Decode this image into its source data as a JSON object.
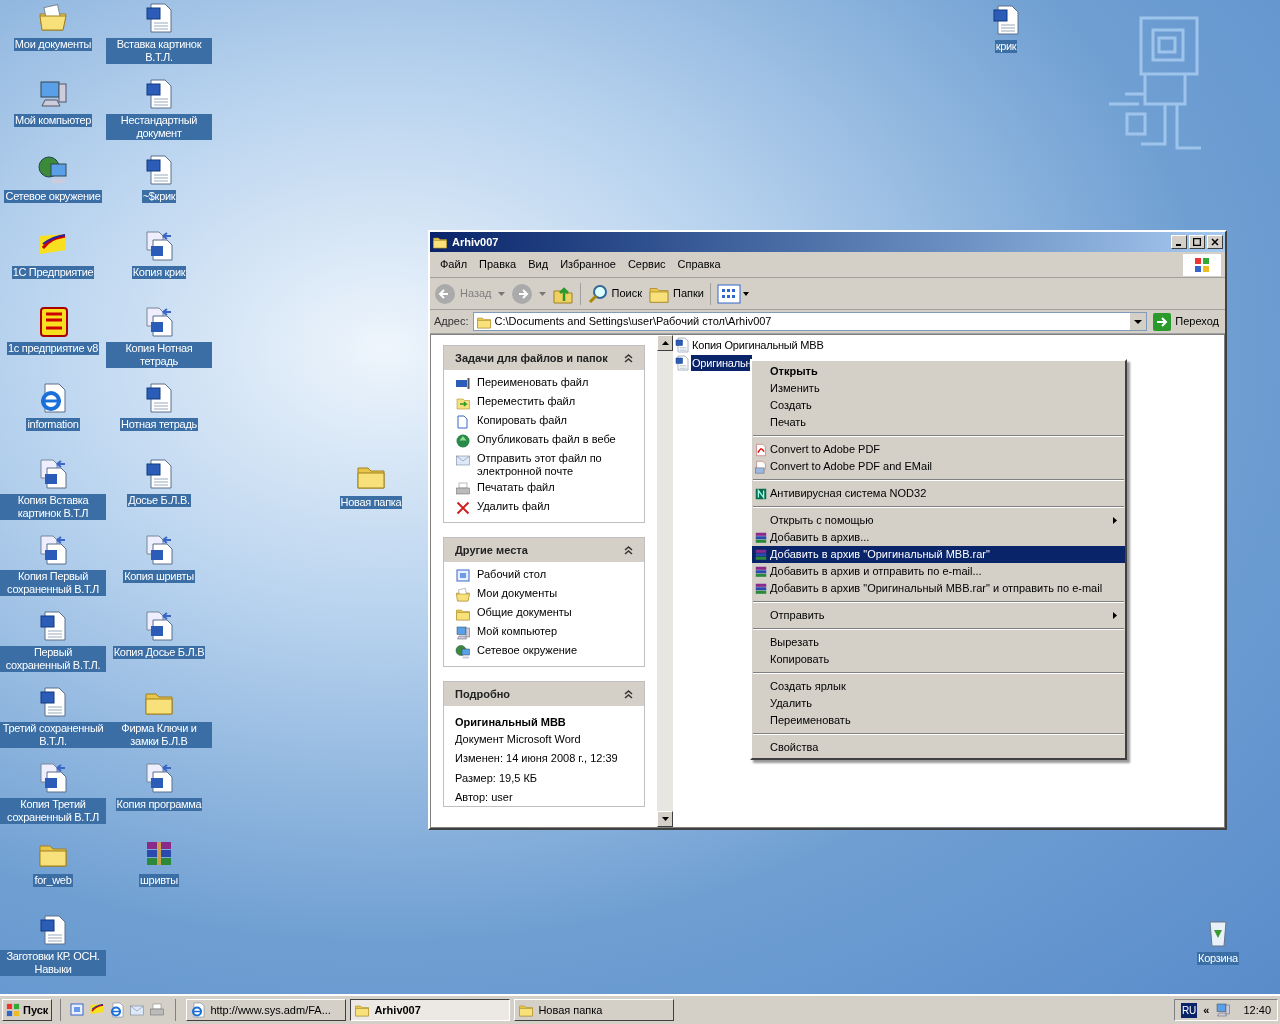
{
  "desktop": {
    "columns": [
      [
        {
          "label": "Мои документы",
          "kind": "mydocs"
        },
        {
          "label": "Мой компьютер",
          "kind": "computer"
        },
        {
          "label": "Сетевое окружение",
          "kind": "network"
        },
        {
          "label": "1С Предприятие",
          "kind": "onec7"
        },
        {
          "label": "1с предприятие v8",
          "kind": "onec8"
        },
        {
          "label": "information",
          "kind": "ie"
        },
        {
          "label": "Копия Вставка картинок В.Т.Л",
          "kind": "copy"
        },
        {
          "label": "Копия Первый сохраненный В.Т.Л",
          "kind": "copy"
        },
        {
          "label": "Первый сохраненный В.Т.Л.",
          "kind": "word"
        },
        {
          "label": "Третий сохраненный В.Т.Л.",
          "kind": "word"
        },
        {
          "label": "Копия Третий сохраненный В.Т.Л",
          "kind": "copy"
        },
        {
          "label": "for_web",
          "kind": "folder"
        },
        {
          "label": "Заготовки КР. ОСН. Навыки",
          "kind": "word"
        }
      ],
      [
        {
          "label": "Вставка картинок В.Т.Л.",
          "kind": "word"
        },
        {
          "label": "Нестандартный документ",
          "kind": "word"
        },
        {
          "label": "~$крик",
          "kind": "word"
        },
        {
          "label": "Копия крик",
          "kind": "copy"
        },
        {
          "label": "Копия Нотная тетрадь",
          "kind": "copy"
        },
        {
          "label": "Нотная тетрадь",
          "kind": "word"
        },
        {
          "label": "Досье Б.Л.В.",
          "kind": "word"
        },
        {
          "label": "Копия шривты",
          "kind": "copy"
        },
        {
          "label": "Копия Досье Б.Л.В",
          "kind": "copy"
        },
        {
          "label": "Фирма Ключи и замки Б.Л.В",
          "kind": "folder"
        },
        {
          "label": "Копия программа",
          "kind": "copy"
        },
        {
          "label": "шривты",
          "kind": "rar"
        }
      ]
    ],
    "loose_icons": [
      {
        "label": "Новая папка",
        "kind": "folder"
      },
      {
        "label": "крик",
        "kind": "word"
      },
      {
        "label": "Корзина",
        "kind": "recycle"
      }
    ]
  },
  "window": {
    "title": "Arhiv007",
    "menu": [
      "Файл",
      "Правка",
      "Вид",
      "Избранное",
      "Сервис",
      "Справка"
    ],
    "toolbar": {
      "back": {
        "label": "Назад",
        "disabled": true
      },
      "search": "Поиск",
      "folders": "Папки"
    },
    "address": {
      "label": "Адрес:",
      "value": "C:\\Documents and Settings\\user\\Рабочий стол\\Arhiv007",
      "go": "Переход"
    },
    "panels": [
      {
        "title": "Задачи для файлов и папок",
        "items": [
          {
            "label": "Переименовать файл",
            "kind": "rename"
          },
          {
            "label": "Переместить файл",
            "kind": "move"
          },
          {
            "label": "Копировать файл",
            "kind": "copyfile"
          },
          {
            "label": "Опубликовать файл в вебе",
            "kind": "web"
          },
          {
            "label": "Отправить этот файл по электронной почте",
            "kind": "mail"
          },
          {
            "label": "Печатать файл",
            "kind": "print"
          },
          {
            "label": "Удалить файл",
            "kind": "delete"
          }
        ]
      },
      {
        "title": "Другие места",
        "items": [
          {
            "label": "Рабочий стол",
            "kind": "desktop"
          },
          {
            "label": "Мои документы",
            "kind": "mydocs"
          },
          {
            "label": "Общие документы",
            "kind": "folder"
          },
          {
            "label": "Мой компьютер",
            "kind": "computer"
          },
          {
            "label": "Сетевое окружение",
            "kind": "network"
          }
        ]
      }
    ],
    "details": {
      "title": "Подробно",
      "name": "Оригинальный MBB",
      "type": "Документ Microsoft Word",
      "lines": [
        "Изменен: 14 июня 2008 г., 12:39",
        "Размер: 19,5 КБ",
        "Автор: user"
      ]
    },
    "files": [
      {
        "name": "Копия Оригинальный MBB",
        "selected": false
      },
      {
        "name": "Оригинальн",
        "selected": true
      }
    ]
  },
  "context_menu": {
    "groups": [
      [
        {
          "label": "Открыть",
          "kind": "plain",
          "bold": true,
          "submenu": false,
          "selected": false
        },
        {
          "label": "Изменить",
          "kind": "plain",
          "bold": false,
          "submenu": false,
          "selected": false
        },
        {
          "label": "Создать",
          "kind": "plain",
          "bold": false,
          "submenu": false,
          "selected": false
        },
        {
          "label": "Печать",
          "kind": "plain",
          "bold": false,
          "submenu": false,
          "selected": false
        }
      ],
      [
        {
          "label": "Convert to Adobe PDF",
          "kind": "pdf",
          "bold": false,
          "submenu": false,
          "selected": false
        },
        {
          "label": "Convert to Adobe PDF and EMail",
          "kind": "pdfmail",
          "bold": false,
          "submenu": false,
          "selected": false
        }
      ],
      [
        {
          "label": "Антивирусная система NOD32",
          "kind": "antivirus",
          "bold": false,
          "submenu": false,
          "selected": false
        }
      ],
      [
        {
          "label": "Открыть с помощью",
          "kind": "plain",
          "bold": false,
          "submenu": true,
          "selected": false
        },
        {
          "label": "Добавить в архив...",
          "kind": "archive",
          "bold": false,
          "submenu": false,
          "selected": false
        },
        {
          "label": "Добавить в архив \"Оригинальный MBB.rar\"",
          "kind": "archive",
          "bold": false,
          "submenu": false,
          "selected": true
        },
        {
          "label": "Добавить в архив и отправить по e-mail...",
          "kind": "archive",
          "bold": false,
          "submenu": false,
          "selected": false
        },
        {
          "label": "Добавить в архив \"Оригинальный MBB.rar\" и отправить по e-mail",
          "kind": "archive",
          "bold": false,
          "submenu": false,
          "selected": false
        }
      ],
      [
        {
          "label": "Отправить",
          "kind": "plain",
          "bold": false,
          "submenu": true,
          "selected": false
        }
      ],
      [
        {
          "label": "Вырезать",
          "kind": "plain",
          "bold": false,
          "submenu": false,
          "selected": false
        },
        {
          "label": "Копировать",
          "kind": "plain",
          "bold": false,
          "submenu": false,
          "selected": false
        }
      ],
      [
        {
          "label": "Создать ярлык",
          "kind": "plain",
          "bold": false,
          "submenu": false,
          "selected": false
        },
        {
          "label": "Удалить",
          "kind": "plain",
          "bold": false,
          "submenu": false,
          "selected": false
        },
        {
          "label": "Переименовать",
          "kind": "plain",
          "bold": false,
          "submenu": false,
          "selected": false
        }
      ],
      [
        {
          "label": "Свойства",
          "kind": "plain",
          "bold": false,
          "submenu": false,
          "selected": false
        }
      ]
    ]
  },
  "taskbar": {
    "start": "Пуск",
    "tasks": [
      {
        "label": "http://www.sys.adm/FA...",
        "kind": "ie",
        "selected": false
      },
      {
        "label": "Arhiv007",
        "kind": "folder",
        "selected": true
      },
      {
        "label": "Новая папка",
        "kind": "folder",
        "selected": false
      }
    ],
    "language": "RU",
    "expand": "«",
    "time": "12:40"
  }
}
